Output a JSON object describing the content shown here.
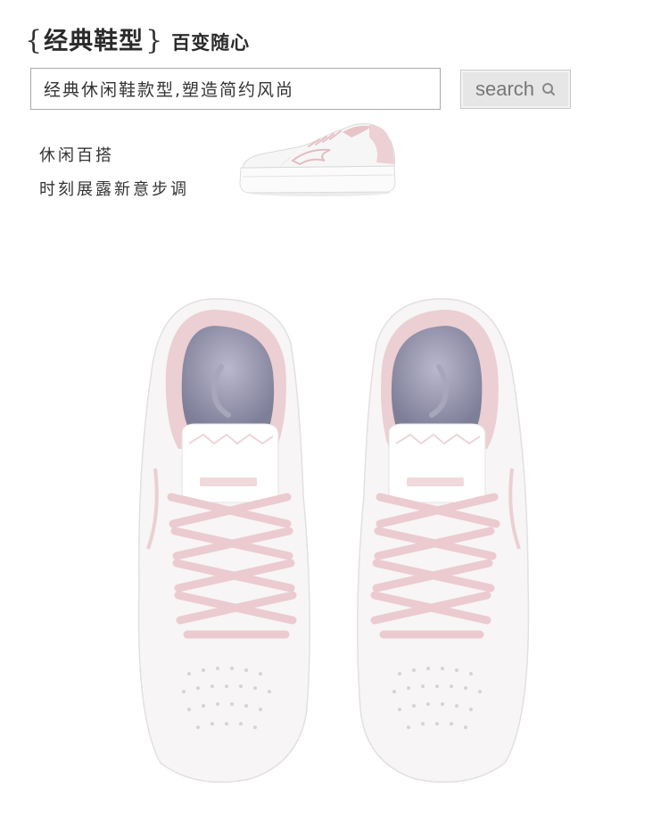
{
  "header": {
    "brace_open": "{",
    "title": "经典鞋型",
    "brace_close": "}",
    "subtitle": "百变随心"
  },
  "search": {
    "value": "经典休闲鞋款型,塑造简约风尚",
    "button_label": "search",
    "button_icon": "search-icon"
  },
  "tagline": {
    "line1": "休闲百搭",
    "line2": "时刻展露新意步调"
  },
  "images": {
    "side_view": "white-pink-sneaker-side",
    "top_view": "white-pink-sneakers-top"
  },
  "colors": {
    "accent_pink": "#e8c9cd",
    "shoe_white": "#f7f5f6",
    "insole_purple": "#8d8ca6",
    "button_bg": "#e6e6e6"
  }
}
